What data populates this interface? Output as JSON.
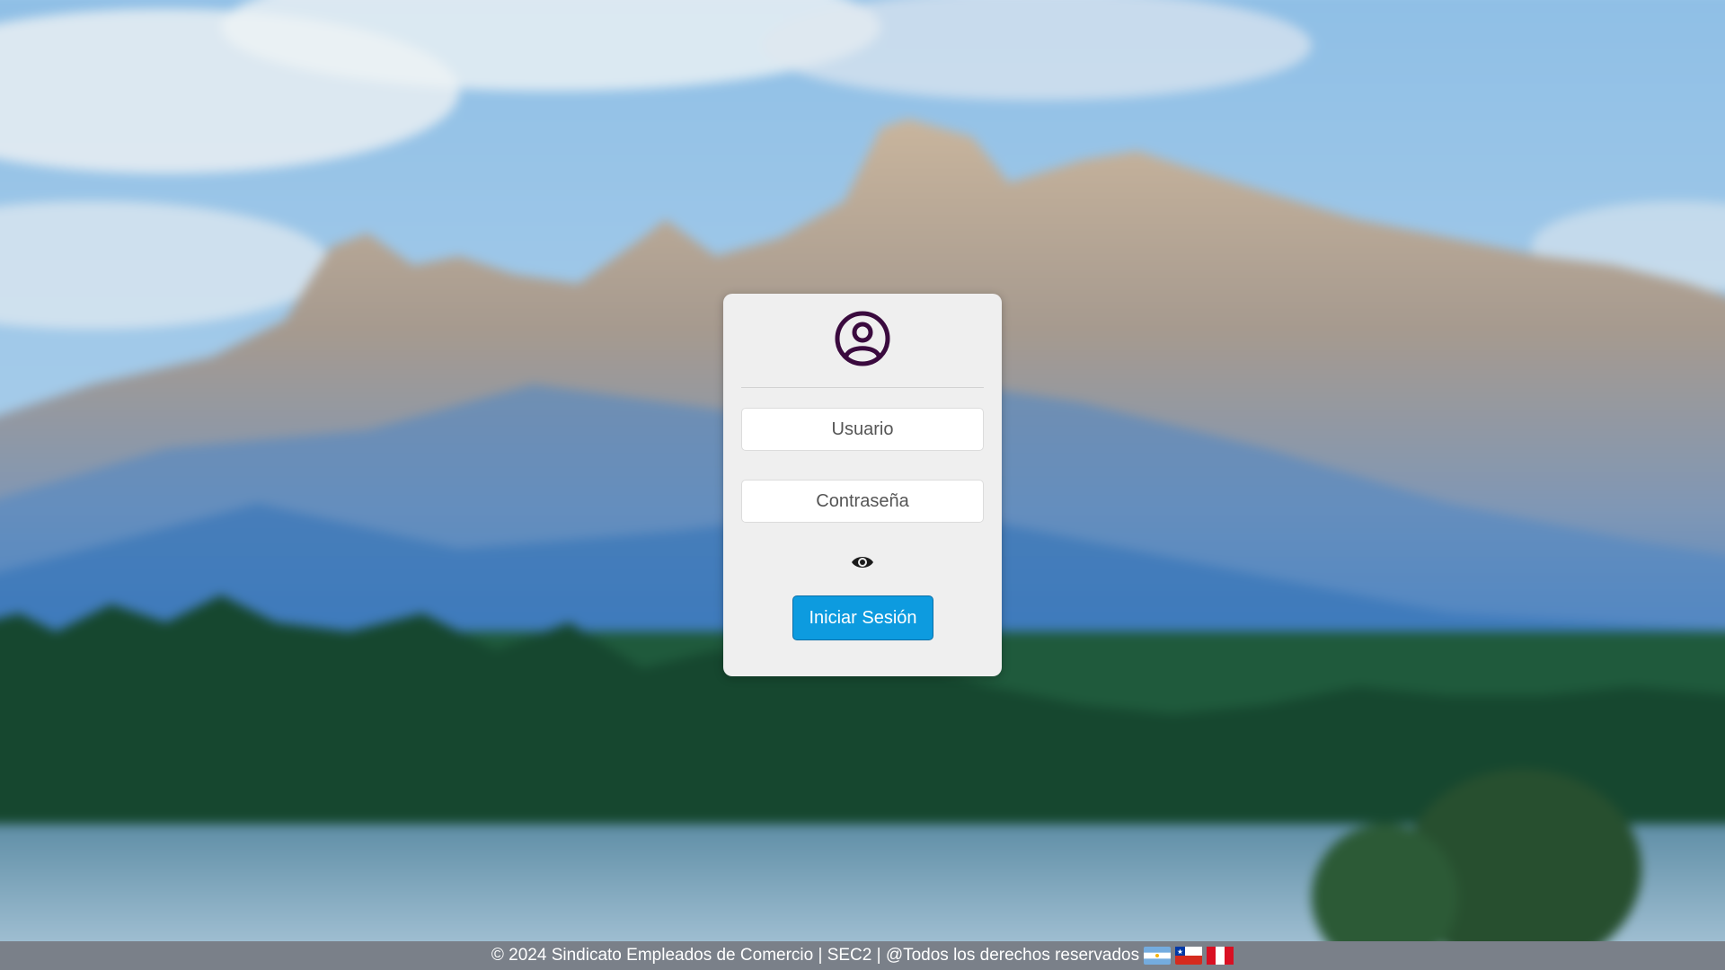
{
  "login": {
    "username_placeholder": "Usuario",
    "password_placeholder": "Contraseña",
    "submit_label": "Iniciar Sesión",
    "avatar_icon": "user-circle-icon",
    "password_toggle_icon": "eye-icon"
  },
  "footer": {
    "text": "© 2024 Sindicato Empleados de Comercio | SEC2 | @Todos los derechos reservados",
    "flags": [
      "argentina-flag-icon",
      "chile-flag-icon",
      "peru-flag-icon"
    ]
  },
  "colors": {
    "button": "#0d9bdf",
    "avatar": "#3a0a3e",
    "footer_bg": "#7a8089",
    "card_bg": "#efefef"
  }
}
